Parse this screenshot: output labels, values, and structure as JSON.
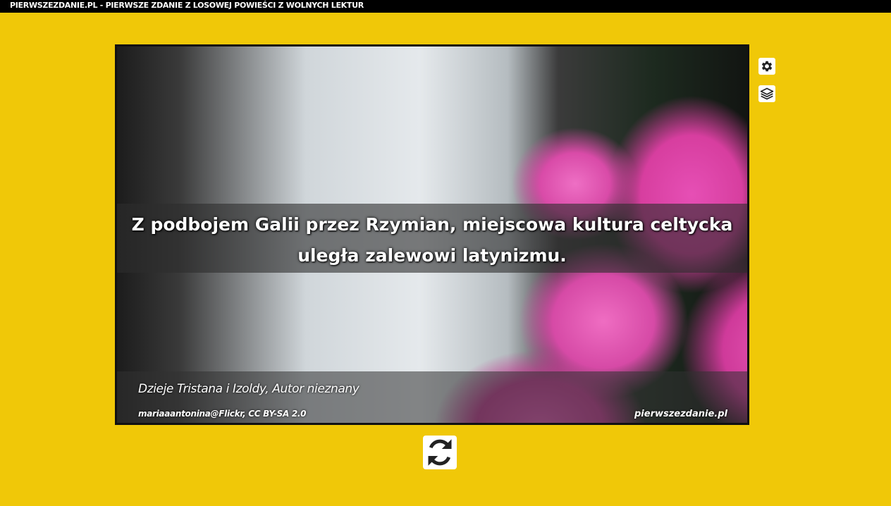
{
  "header": {
    "title": "PIERWSZEZDANIE.PL - PIERWSZE ZDANIE Z LOSOWEJ POWIEŚCI Z WOLNYCH LEKTUR"
  },
  "card": {
    "quote": "Z podbojem Galii przez Rzymian, miejscowa kultura celtycka uległa zalewowi latynizmu.",
    "source": "Dzieje Tristana i Izoldy, Autor nieznany",
    "photo_credit": "mariaaantonina@Flickr, CC BY-SA 2.0",
    "site": "pierwszezdanie.pl"
  },
  "sidebar": {
    "settings_icon": "gear-icon",
    "layers_icon": "layers-icon"
  },
  "actions": {
    "refresh_icon": "refresh-icon"
  },
  "colors": {
    "background": "#f0c808",
    "header_bg": "#000000",
    "button_bg": "#ffffff"
  }
}
